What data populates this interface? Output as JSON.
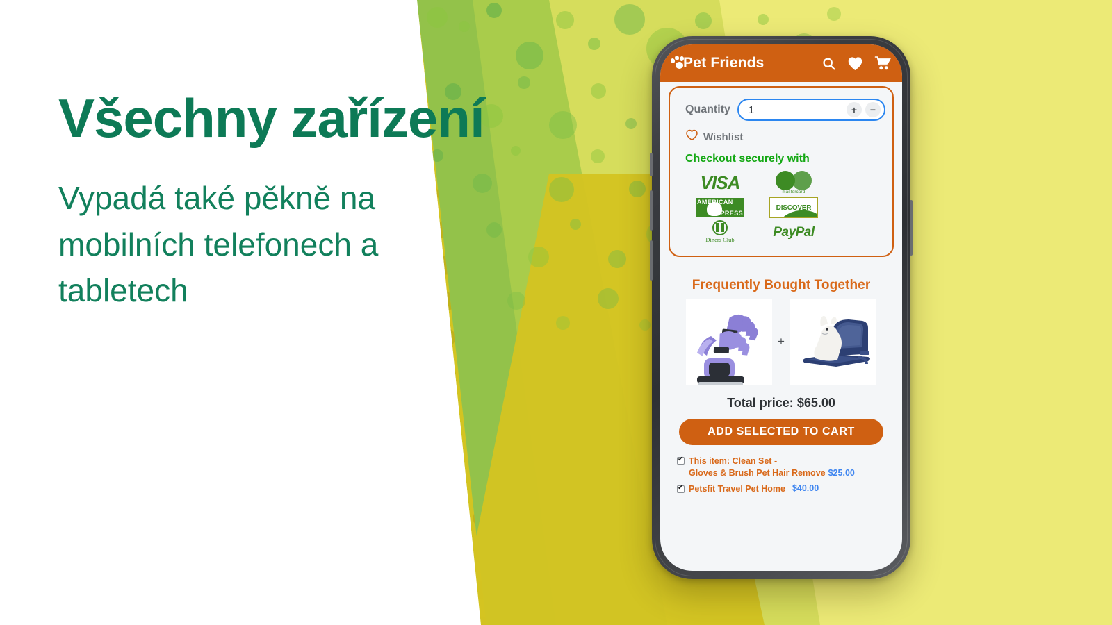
{
  "promo": {
    "headline": "Všechny zařízení",
    "subcopy": "Vypadá také pěkně na mobilních telefonech a tabletech",
    "accent_green": "#0d7a56",
    "accent_yellow": "#d3c421",
    "accent_lime": "#a9cc4b"
  },
  "app": {
    "brand": "Pet Friends",
    "brand_color": "#cf6012",
    "header_icons": [
      "search-icon",
      "heart-icon",
      "cart-icon"
    ],
    "quantity": {
      "label": "Quantity",
      "value": "1",
      "increment_label": "+",
      "decrement_label": "−"
    },
    "wishlist": {
      "label": "Wishlist",
      "icon": "heart-outline-icon"
    },
    "checkout": {
      "title": "Checkout securely with",
      "title_color": "#14a814",
      "methods": [
        "VISA",
        "mastercard",
        "AMERICAN EXPRESS",
        "DISCOVER",
        "Diners Club",
        "PayPal"
      ]
    },
    "fbt": {
      "title": "Frequently Bought Together",
      "plus": "+",
      "image_1_alt": "pet grooming gloves and brush",
      "image_2_alt": "white dog in navy travel pet carrier",
      "total_label": "Total price:",
      "total_value": "$65.00",
      "cart_button": "ADD SELECTED TO CART",
      "items": [
        {
          "prefix": "This item: Clean Set -",
          "name": "Gloves & Brush Pet Hair Remove",
          "price": "$25.00",
          "checked": true
        },
        {
          "prefix": "",
          "name": "Petsfit Travel Pet Home",
          "price": "$40.00",
          "checked": true
        }
      ]
    }
  }
}
